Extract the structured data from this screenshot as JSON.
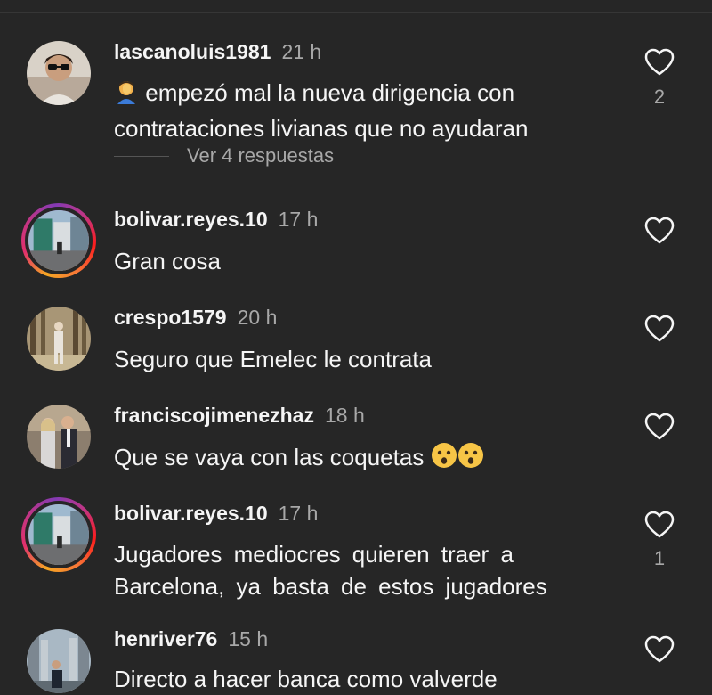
{
  "comments": [
    {
      "username": "lascanoluis1981",
      "time": "21 h",
      "text": "empezó mal la nueva dirigencia con contrataciones livianas que no ayudaran",
      "likes": "2",
      "replies_label": "Ver 4 respuestas",
      "prefix_emoji": "facepalm-emoji"
    },
    {
      "username": "bolivar.reyes.10",
      "time": "17 h",
      "text": "Gran  cosa",
      "likes": ""
    },
    {
      "username": "crespo1579",
      "time": "20 h",
      "text": "Seguro que Emelec le contrata",
      "likes": ""
    },
    {
      "username": "franciscojimenezhaz",
      "time": "18 h",
      "text": "Que se vaya con las coquetas",
      "likes": "",
      "suffix_emoji": "hushed-face-emoji ×2"
    },
    {
      "username": "bolivar.reyes.10",
      "time": "17 h",
      "text": "Jugadores mediocres quieren traer a Barcelona, ya basta de estos jugadores",
      "likes": "1"
    },
    {
      "username": "henriver76",
      "time": "15 h",
      "text": "Directo a hacer banca como valverde",
      "likes": ""
    }
  ],
  "colors": {
    "background": "#262626",
    "text": "#f5f5f5",
    "muted": "#a8a8a8",
    "story_ring": "#e1306c"
  },
  "icons": {
    "like": "heart-outline-icon"
  }
}
